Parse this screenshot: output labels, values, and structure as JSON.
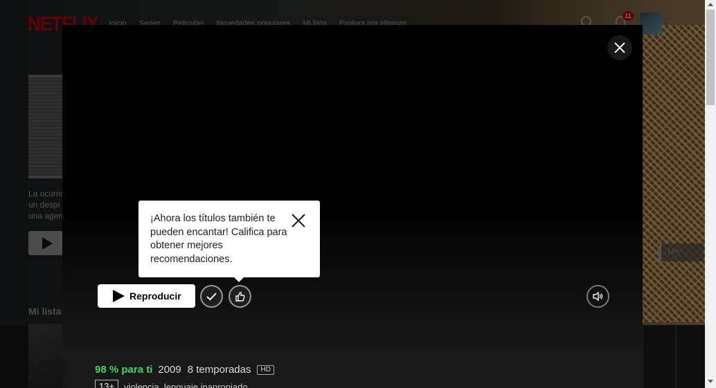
{
  "nav": {
    "logo": "NETFLIX",
    "links": [
      "Inicio",
      "Series",
      "Películas",
      "Novedades populares",
      "Mi lista",
      "Explora por idiomas"
    ],
    "notification_count": "11",
    "icons": {
      "search": "search-icon",
      "bell": "bell-icon",
      "caret": "caret-down-icon"
    }
  },
  "hero": {
    "description_lines": [
      "La ocurre",
      "un despi",
      "una agen"
    ],
    "maturity_rating": "16+"
  },
  "row": {
    "heading": "Mi lista"
  },
  "modal": {
    "play_label": "Reproducir",
    "tooltip_text": "¡Ahora los títulos también te pueden encantar! Califica para obtener mejores recomendaciones.",
    "meta": {
      "match": "98 % para ti",
      "year": "2009",
      "seasons": "8 temporadas",
      "quality": "HD",
      "maturity": "13+",
      "maturity_reasons": "violencia, lenguaje inapropiado"
    },
    "icons": {
      "close": "close-icon",
      "add_to_list": "check-icon",
      "rate": "thumbs-up-icon",
      "audio": "speaker-icon",
      "play": "play-icon"
    }
  },
  "colors": {
    "brand_red": "#b20710",
    "match_green": "#46d369",
    "modal_bg": "#181818"
  }
}
